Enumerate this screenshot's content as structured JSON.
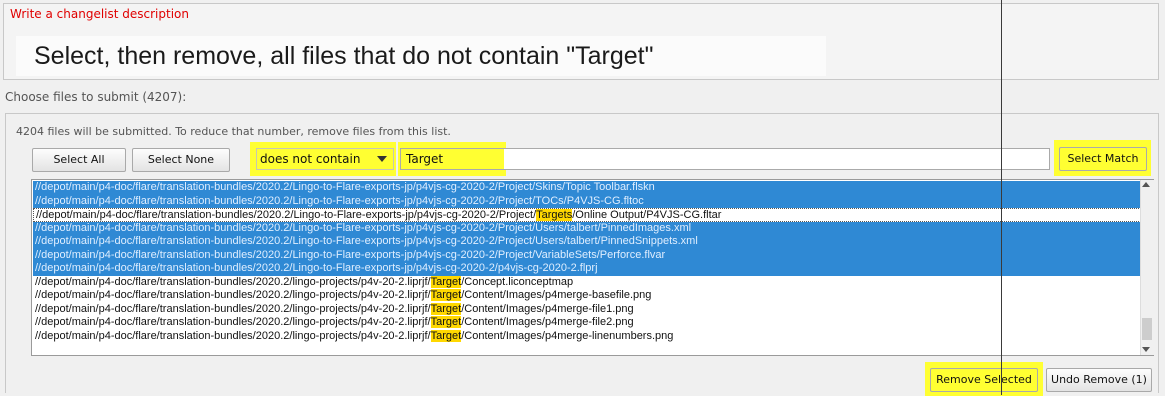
{
  "description_section": {
    "label": "Write a changelist description",
    "text": "Select, then remove, all files that do not contain \"Target\""
  },
  "files_section": {
    "label": "Choose files to submit (4207):",
    "info": "4204 files will be submitted. To reduce that number, remove files from this list."
  },
  "toolbar": {
    "select_all_label": "Select All",
    "select_none_label": "Select None",
    "filter_mode": "does not contain",
    "filter_value": "Target",
    "select_match_label": "Select Match"
  },
  "file_list": [
    {
      "pre": "//depot/main/p4-doc/flare/translation-bundles/2020.2/Lingo-to-Flare-exports-jp/p4vjs-cg-2020-2/Project/Skins/Topic Toolbar.flskn",
      "match": "",
      "post": "",
      "selected": true
    },
    {
      "pre": "//depot/main/p4-doc/flare/translation-bundles/2020.2/Lingo-to-Flare-exports-jp/p4vjs-cg-2020-2/Project/TOCs/P4VJS-CG.fltoc",
      "match": "",
      "post": "",
      "selected": true
    },
    {
      "pre": "//depot/main/p4-doc/flare/translation-bundles/2020.2/Lingo-to-Flare-exports-jp/p4vjs-cg-2020-2/Project/",
      "match": "Targets",
      "post": "/Online Output/P4VJS-CG.fltar",
      "selected": false
    },
    {
      "pre": "//depot/main/p4-doc/flare/translation-bundles/2020.2/Lingo-to-Flare-exports-jp/p4vjs-cg-2020-2/Project/Users/talbert/PinnedImages.xml",
      "match": "",
      "post": "",
      "selected": true
    },
    {
      "pre": "//depot/main/p4-doc/flare/translation-bundles/2020.2/Lingo-to-Flare-exports-jp/p4vjs-cg-2020-2/Project/Users/talbert/PinnedSnippets.xml",
      "match": "",
      "post": "",
      "selected": true
    },
    {
      "pre": "//depot/main/p4-doc/flare/translation-bundles/2020.2/Lingo-to-Flare-exports-jp/p4vjs-cg-2020-2/Project/VariableSets/Perforce.flvar",
      "match": "",
      "post": "",
      "selected": true
    },
    {
      "pre": "//depot/main/p4-doc/flare/translation-bundles/2020.2/Lingo-to-Flare-exports-jp/p4vjs-cg-2020-2/p4vjs-cg-2020-2.flprj",
      "match": "",
      "post": "",
      "selected": true
    },
    {
      "pre": "//depot/main/p4-doc/flare/translation-bundles/2020.2/lingo-projects/p4v-20-2.liprjf/",
      "match": "Target",
      "post": "/Concept.liconceptmap",
      "selected": false
    },
    {
      "pre": "//depot/main/p4-doc/flare/translation-bundles/2020.2/lingo-projects/p4v-20-2.liprjf/",
      "match": "Target",
      "post": "/Content/Images/p4merge-basefile.png",
      "selected": false
    },
    {
      "pre": "//depot/main/p4-doc/flare/translation-bundles/2020.2/lingo-projects/p4v-20-2.liprjf/",
      "match": "Target",
      "post": "/Content/Images/p4merge-file1.png",
      "selected": false
    },
    {
      "pre": "//depot/main/p4-doc/flare/translation-bundles/2020.2/lingo-projects/p4v-20-2.liprjf/",
      "match": "Target",
      "post": "/Content/Images/p4merge-file2.png",
      "selected": false
    },
    {
      "pre": "//depot/main/p4-doc/flare/translation-bundles/2020.2/lingo-projects/p4v-20-2.liprjf/",
      "match": "Target",
      "post": "/Content/Images/p4merge-linenumbers.png",
      "selected": false
    }
  ],
  "actions": {
    "remove_selected_label": "Remove Selected",
    "undo_remove_label": "Undo Remove (1)"
  },
  "colors": {
    "highlight": "#ffff32",
    "selection": "#2f89d4",
    "label_red": "#e00000"
  }
}
